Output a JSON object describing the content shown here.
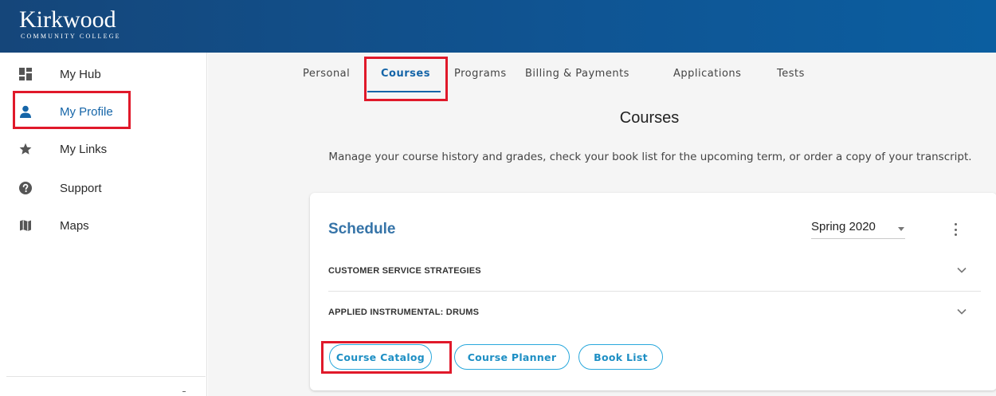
{
  "brand": {
    "name": "Kirkwood",
    "subtitle": "COMMUNITY COLLEGE"
  },
  "sidebar": {
    "items": [
      {
        "label": "My Hub",
        "icon": "dashboard-icon"
      },
      {
        "label": "My Profile",
        "icon": "person-icon",
        "active": true
      },
      {
        "label": "My Links",
        "icon": "star-icon"
      },
      {
        "label": "Support",
        "icon": "help-icon"
      },
      {
        "label": "Maps",
        "icon": "map-icon"
      }
    ]
  },
  "tabs": [
    {
      "label": "Personal"
    },
    {
      "label": "Courses",
      "active": true
    },
    {
      "label": "Programs"
    },
    {
      "label": "Billing & Payments"
    },
    {
      "label": "Applications"
    },
    {
      "label": "Tests"
    }
  ],
  "page": {
    "title": "Courses",
    "description": "Manage your course history and grades, check your book list for the upcoming term, or order a copy of your transcript."
  },
  "schedule": {
    "title": "Schedule",
    "term": "Spring 2020",
    "courses": [
      {
        "name": "CUSTOMER SERVICE STRATEGIES"
      },
      {
        "name": "APPLIED INSTRUMENTAL: DRUMS"
      }
    ],
    "buttons": [
      {
        "label": "Course Catalog"
      },
      {
        "label": "Course Planner"
      },
      {
        "label": "Book List"
      }
    ]
  },
  "colors": {
    "header": "#0f5594",
    "accent": "#1565a8",
    "pill_border": "#29a8dc",
    "highlight": "#e0192a"
  }
}
